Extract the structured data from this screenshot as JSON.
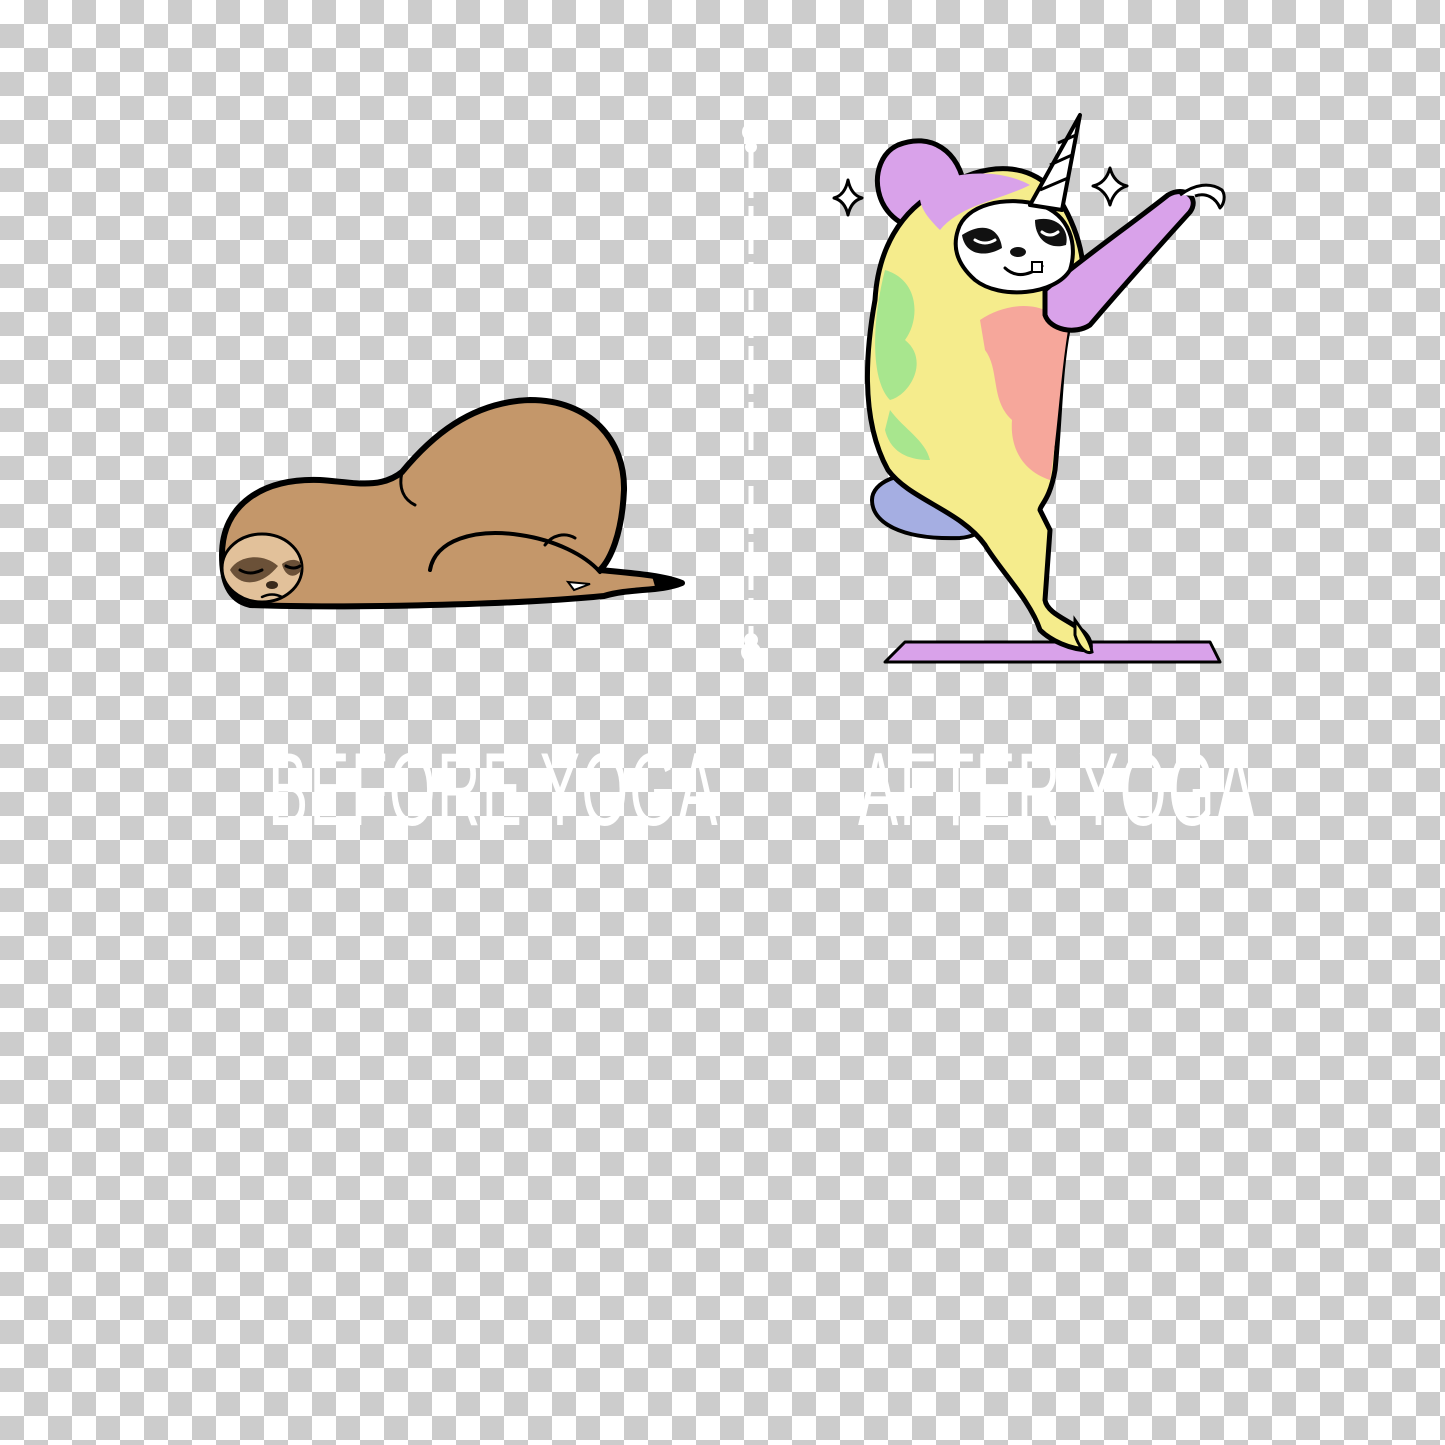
{
  "captions": {
    "before": "BEFORE YOGA",
    "after": "AFTER YOGA"
  },
  "colors": {
    "sloth_fur": "#c4976a",
    "sloth_face": "#e2c19a",
    "sloth_mask": "#6b5138",
    "rainbow_yellow": "#f5ec8c",
    "rainbow_green": "#a8e68e",
    "rainbow_pink": "#f6a79b",
    "rainbow_purple": "#d9a2ea",
    "rainbow_blue": "#a5aee2",
    "mat": "#d9a2ea",
    "caption_text": "#ffffff",
    "outline": "#000000"
  },
  "icons": [
    "sleeping-sloth-illustration",
    "unicorn-sloth-illustration",
    "sparkle-icon",
    "divider-line"
  ]
}
